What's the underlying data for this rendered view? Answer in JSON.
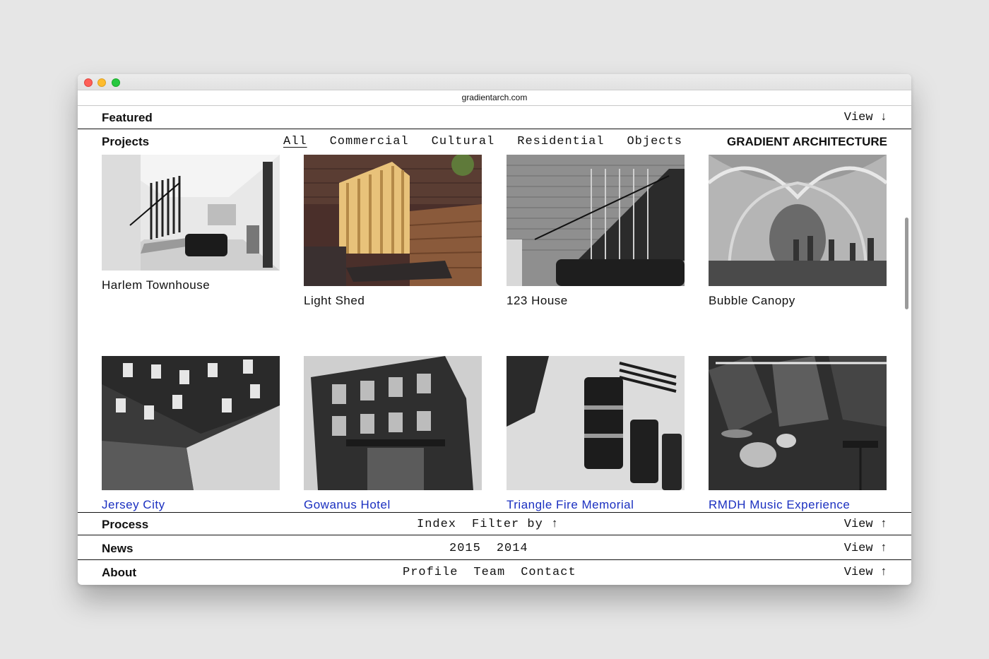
{
  "browser": {
    "url": "gradientarch.com"
  },
  "featured": {
    "title": "Featured",
    "view": "View ↓"
  },
  "projects": {
    "title": "Projects",
    "filters": [
      "All",
      "Commercial",
      "Cultural",
      "Residential",
      "Objects"
    ],
    "active_filter": "All",
    "brand": "GRADIENT ARCHITECTURE",
    "items": [
      {
        "name": "Harlem Townhouse"
      },
      {
        "name": "Light Shed"
      },
      {
        "name": "123 House"
      },
      {
        "name": "Bubble Canopy"
      },
      {
        "name": "Jersey City"
      },
      {
        "name": "Gowanus Hotel"
      },
      {
        "name": "Triangle Fire Memorial"
      },
      {
        "name": "RMDH Music Experience"
      }
    ]
  },
  "process": {
    "title": "Process",
    "links": [
      "Index",
      "Filter by ↑"
    ],
    "view": "View ↑"
  },
  "news": {
    "title": "News",
    "links": [
      "2015",
      "2014"
    ],
    "view": "View ↑"
  },
  "about": {
    "title": "About",
    "links": [
      "Profile",
      "Team",
      "Contact"
    ],
    "view": "View ↑"
  },
  "colors": {
    "accent_blue": "#2646ff",
    "text": "#111111"
  }
}
